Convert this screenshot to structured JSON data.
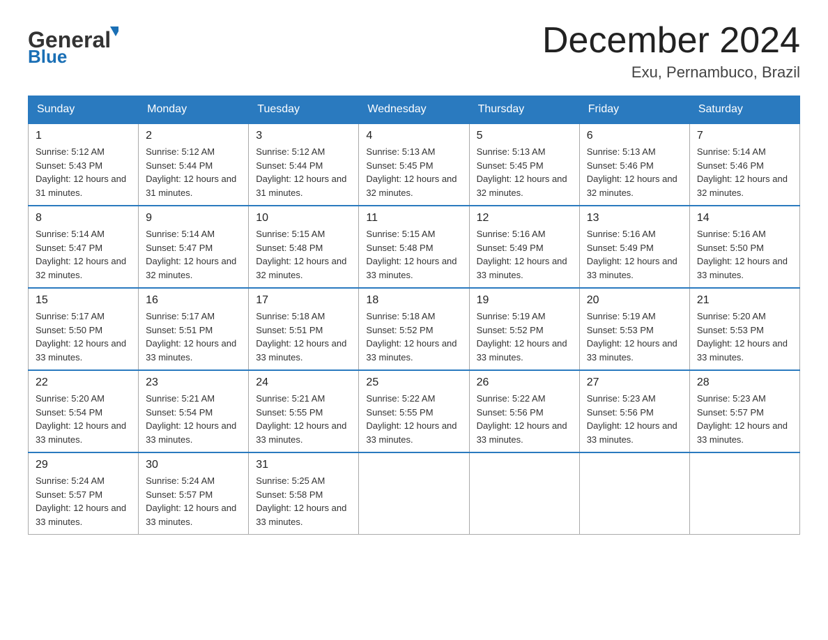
{
  "header": {
    "logo_general": "General",
    "logo_blue": "Blue",
    "month_title": "December 2024",
    "location": "Exu, Pernambuco, Brazil"
  },
  "days_of_week": [
    "Sunday",
    "Monday",
    "Tuesday",
    "Wednesday",
    "Thursday",
    "Friday",
    "Saturday"
  ],
  "weeks": [
    [
      {
        "day": "1",
        "sunrise": "5:12 AM",
        "sunset": "5:43 PM",
        "daylight": "12 hours and 31 minutes."
      },
      {
        "day": "2",
        "sunrise": "5:12 AM",
        "sunset": "5:44 PM",
        "daylight": "12 hours and 31 minutes."
      },
      {
        "day": "3",
        "sunrise": "5:12 AM",
        "sunset": "5:44 PM",
        "daylight": "12 hours and 31 minutes."
      },
      {
        "day": "4",
        "sunrise": "5:13 AM",
        "sunset": "5:45 PM",
        "daylight": "12 hours and 32 minutes."
      },
      {
        "day": "5",
        "sunrise": "5:13 AM",
        "sunset": "5:45 PM",
        "daylight": "12 hours and 32 minutes."
      },
      {
        "day": "6",
        "sunrise": "5:13 AM",
        "sunset": "5:46 PM",
        "daylight": "12 hours and 32 minutes."
      },
      {
        "day": "7",
        "sunrise": "5:14 AM",
        "sunset": "5:46 PM",
        "daylight": "12 hours and 32 minutes."
      }
    ],
    [
      {
        "day": "8",
        "sunrise": "5:14 AM",
        "sunset": "5:47 PM",
        "daylight": "12 hours and 32 minutes."
      },
      {
        "day": "9",
        "sunrise": "5:14 AM",
        "sunset": "5:47 PM",
        "daylight": "12 hours and 32 minutes."
      },
      {
        "day": "10",
        "sunrise": "5:15 AM",
        "sunset": "5:48 PM",
        "daylight": "12 hours and 32 minutes."
      },
      {
        "day": "11",
        "sunrise": "5:15 AM",
        "sunset": "5:48 PM",
        "daylight": "12 hours and 33 minutes."
      },
      {
        "day": "12",
        "sunrise": "5:16 AM",
        "sunset": "5:49 PM",
        "daylight": "12 hours and 33 minutes."
      },
      {
        "day": "13",
        "sunrise": "5:16 AM",
        "sunset": "5:49 PM",
        "daylight": "12 hours and 33 minutes."
      },
      {
        "day": "14",
        "sunrise": "5:16 AM",
        "sunset": "5:50 PM",
        "daylight": "12 hours and 33 minutes."
      }
    ],
    [
      {
        "day": "15",
        "sunrise": "5:17 AM",
        "sunset": "5:50 PM",
        "daylight": "12 hours and 33 minutes."
      },
      {
        "day": "16",
        "sunrise": "5:17 AM",
        "sunset": "5:51 PM",
        "daylight": "12 hours and 33 minutes."
      },
      {
        "day": "17",
        "sunrise": "5:18 AM",
        "sunset": "5:51 PM",
        "daylight": "12 hours and 33 minutes."
      },
      {
        "day": "18",
        "sunrise": "5:18 AM",
        "sunset": "5:52 PM",
        "daylight": "12 hours and 33 minutes."
      },
      {
        "day": "19",
        "sunrise": "5:19 AM",
        "sunset": "5:52 PM",
        "daylight": "12 hours and 33 minutes."
      },
      {
        "day": "20",
        "sunrise": "5:19 AM",
        "sunset": "5:53 PM",
        "daylight": "12 hours and 33 minutes."
      },
      {
        "day": "21",
        "sunrise": "5:20 AM",
        "sunset": "5:53 PM",
        "daylight": "12 hours and 33 minutes."
      }
    ],
    [
      {
        "day": "22",
        "sunrise": "5:20 AM",
        "sunset": "5:54 PM",
        "daylight": "12 hours and 33 minutes."
      },
      {
        "day": "23",
        "sunrise": "5:21 AM",
        "sunset": "5:54 PM",
        "daylight": "12 hours and 33 minutes."
      },
      {
        "day": "24",
        "sunrise": "5:21 AM",
        "sunset": "5:55 PM",
        "daylight": "12 hours and 33 minutes."
      },
      {
        "day": "25",
        "sunrise": "5:22 AM",
        "sunset": "5:55 PM",
        "daylight": "12 hours and 33 minutes."
      },
      {
        "day": "26",
        "sunrise": "5:22 AM",
        "sunset": "5:56 PM",
        "daylight": "12 hours and 33 minutes."
      },
      {
        "day": "27",
        "sunrise": "5:23 AM",
        "sunset": "5:56 PM",
        "daylight": "12 hours and 33 minutes."
      },
      {
        "day": "28",
        "sunrise": "5:23 AM",
        "sunset": "5:57 PM",
        "daylight": "12 hours and 33 minutes."
      }
    ],
    [
      {
        "day": "29",
        "sunrise": "5:24 AM",
        "sunset": "5:57 PM",
        "daylight": "12 hours and 33 minutes."
      },
      {
        "day": "30",
        "sunrise": "5:24 AM",
        "sunset": "5:57 PM",
        "daylight": "12 hours and 33 minutes."
      },
      {
        "day": "31",
        "sunrise": "5:25 AM",
        "sunset": "5:58 PM",
        "daylight": "12 hours and 33 minutes."
      },
      null,
      null,
      null,
      null
    ]
  ],
  "labels": {
    "sunrise_prefix": "Sunrise: ",
    "sunset_prefix": "Sunset: ",
    "daylight_prefix": "Daylight: "
  }
}
